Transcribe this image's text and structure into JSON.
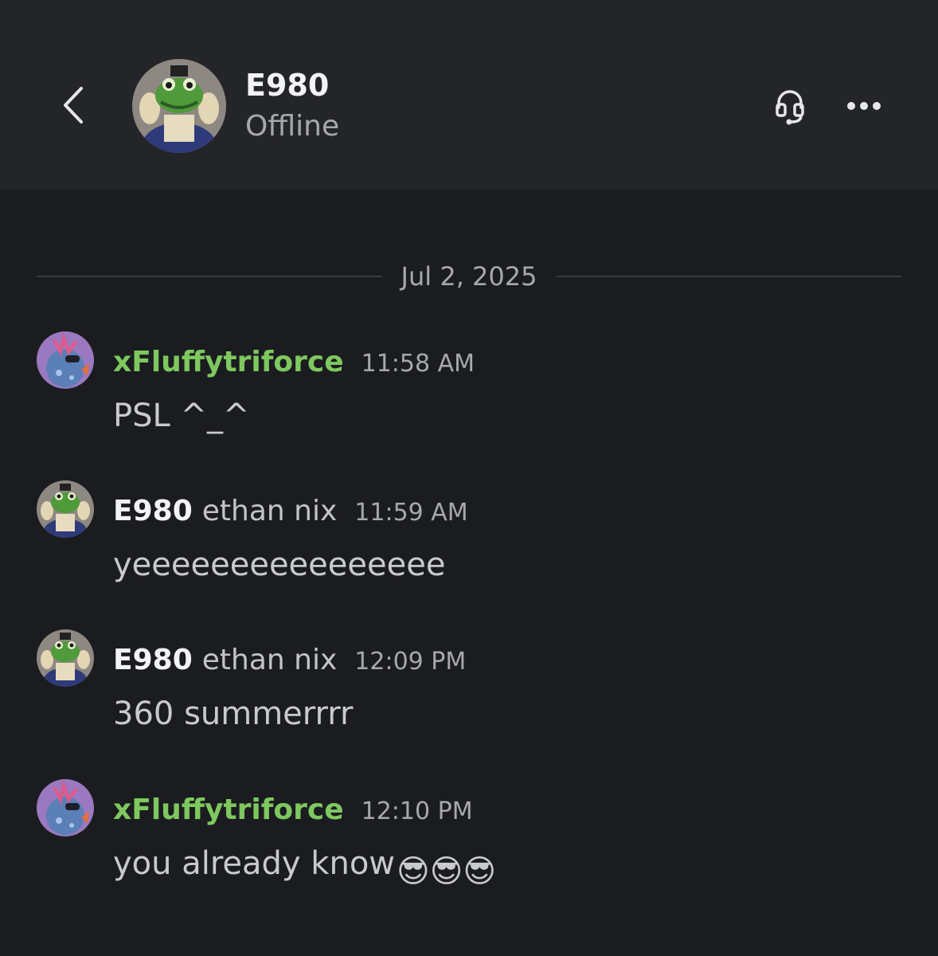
{
  "header": {
    "name": "E980",
    "status": "Offline",
    "icons": {
      "back": "chevron-left-icon",
      "call": "headset-call-icon",
      "more": "more-dots-icon"
    }
  },
  "divider": {
    "date": "Jul 2, 2025"
  },
  "colors": {
    "background": "#1b1c20",
    "header": "#242529",
    "username_green": "#7ec85f",
    "text": "#c8cacd",
    "muted": "#a6a8ad"
  },
  "messages": [
    {
      "author": "xFluffytriforce",
      "nick": "",
      "time": "11:58 AM",
      "text": "PSL ^_^",
      "emoji": ""
    },
    {
      "author": "E980",
      "nick": "ethan nix",
      "time": "11:59 AM",
      "text": "yeeeeeeeeeeeeeeee",
      "emoji": ""
    },
    {
      "author": "E980",
      "nick": "ethan nix",
      "time": "12:09 PM",
      "text": "360 summerrrr",
      "emoji": ""
    },
    {
      "author": "xFluffytriforce",
      "nick": "",
      "time": "12:10 PM",
      "text": "you already know",
      "emoji": "😎😎😎"
    }
  ]
}
